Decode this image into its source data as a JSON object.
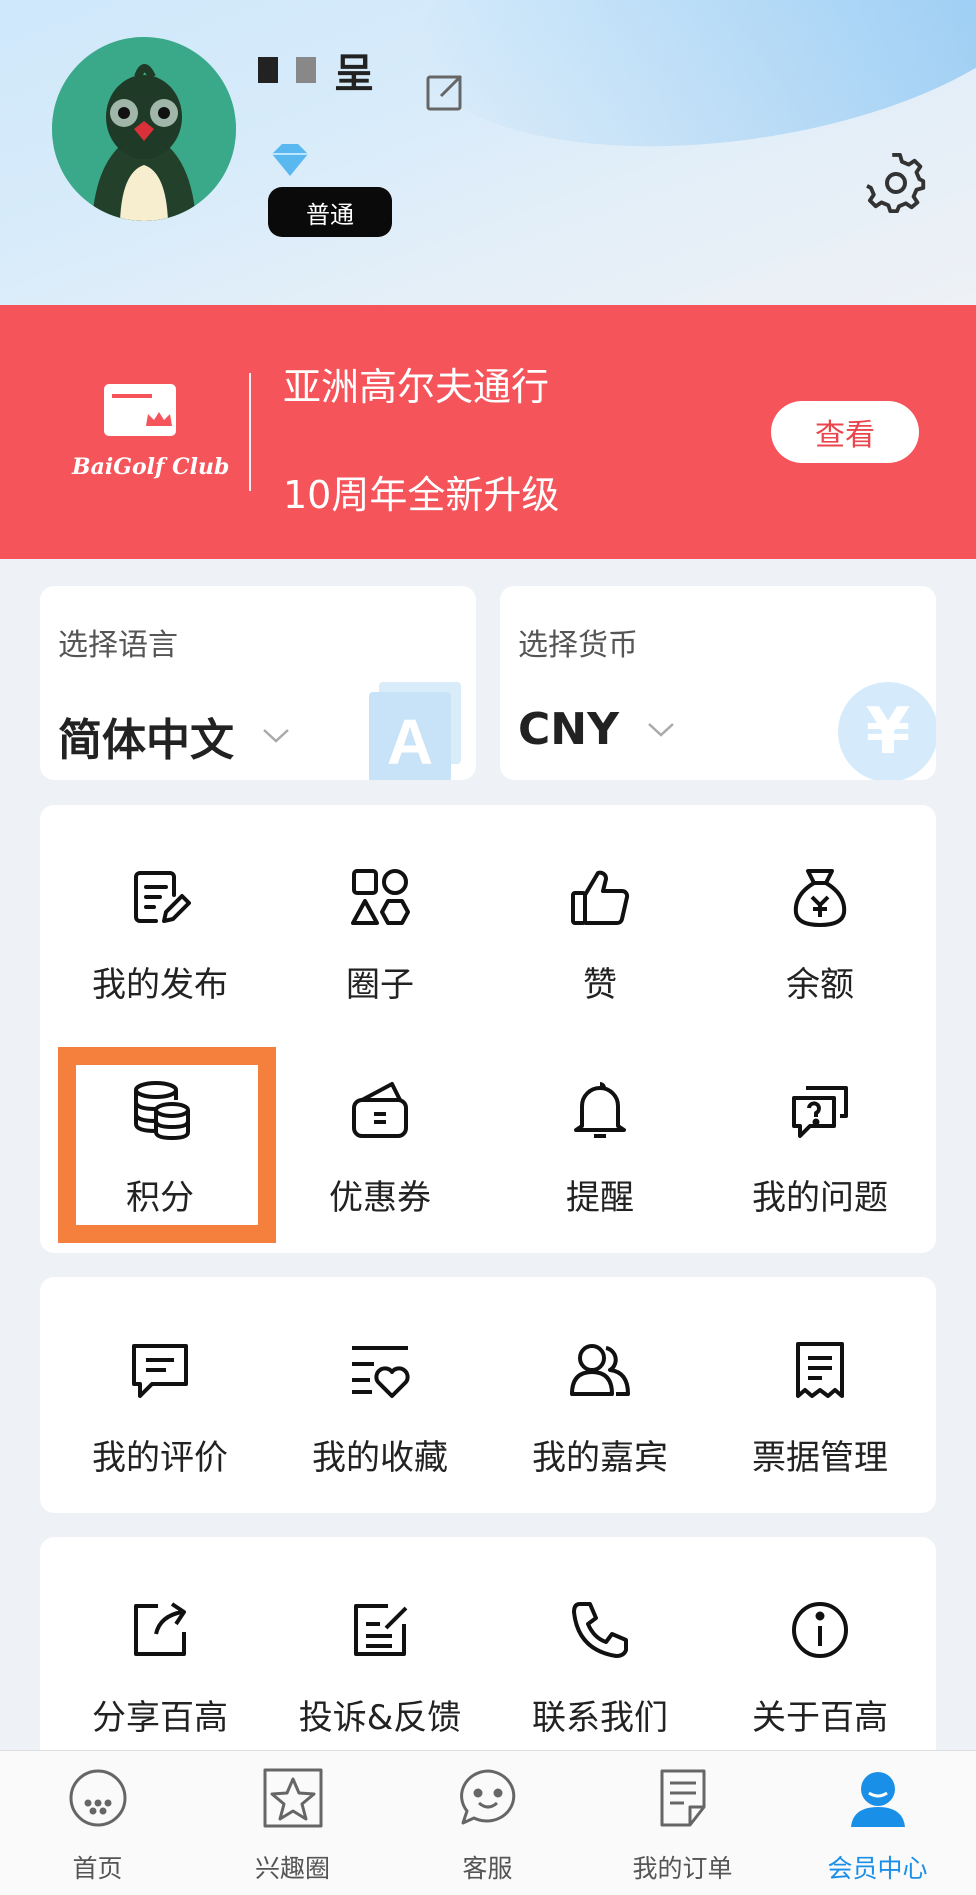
{
  "profile": {
    "username_tail": "呈",
    "level": "普通"
  },
  "banner": {
    "brand": "BaiGolf Club",
    "line1": "亚洲高尔夫通行",
    "line2": "10周年全新升级",
    "button": "查看"
  },
  "language": {
    "label": "选择语言",
    "value": "简体中文"
  },
  "currency": {
    "label": "选择货币",
    "value": "CNY",
    "symbol": "¥"
  },
  "features": [
    {
      "label": "我的发布",
      "icon": "edit-doc-icon"
    },
    {
      "label": "圈子",
      "icon": "shapes-icon"
    },
    {
      "label": "赞",
      "icon": "thumbs-up-icon"
    },
    {
      "label": "余额",
      "icon": "money-bag-icon"
    },
    {
      "label": "积分",
      "icon": "coins-stack-icon"
    },
    {
      "label": "优惠券",
      "icon": "wallet-icon"
    },
    {
      "label": "提醒",
      "icon": "bell-icon"
    },
    {
      "label": "我的问题",
      "icon": "question-chat-icon"
    }
  ],
  "services": [
    {
      "label": "我的评价",
      "icon": "comment-icon"
    },
    {
      "label": "我的收藏",
      "icon": "favorites-icon"
    },
    {
      "label": "我的嘉宾",
      "icon": "guests-icon"
    },
    {
      "label": "票据管理",
      "icon": "receipt-icon"
    }
  ],
  "more": [
    {
      "label": "分享百高",
      "icon": "share-icon"
    },
    {
      "label": "投诉&反馈",
      "icon": "feedback-icon"
    },
    {
      "label": "联系我们",
      "icon": "phone-icon"
    },
    {
      "label": "关于百高",
      "icon": "info-icon"
    }
  ],
  "tabs": [
    {
      "label": "首页",
      "icon": "golf-ball-icon"
    },
    {
      "label": "兴趣圈",
      "icon": "star-icon"
    },
    {
      "label": "客服",
      "icon": "chat-face-icon"
    },
    {
      "label": "我的订单",
      "icon": "order-icon"
    },
    {
      "label": "会员中心",
      "icon": "member-icon"
    }
  ],
  "colors": {
    "accent": "#1a8fe8",
    "banner": "#f4545a",
    "highlight": "#f57f3d"
  }
}
